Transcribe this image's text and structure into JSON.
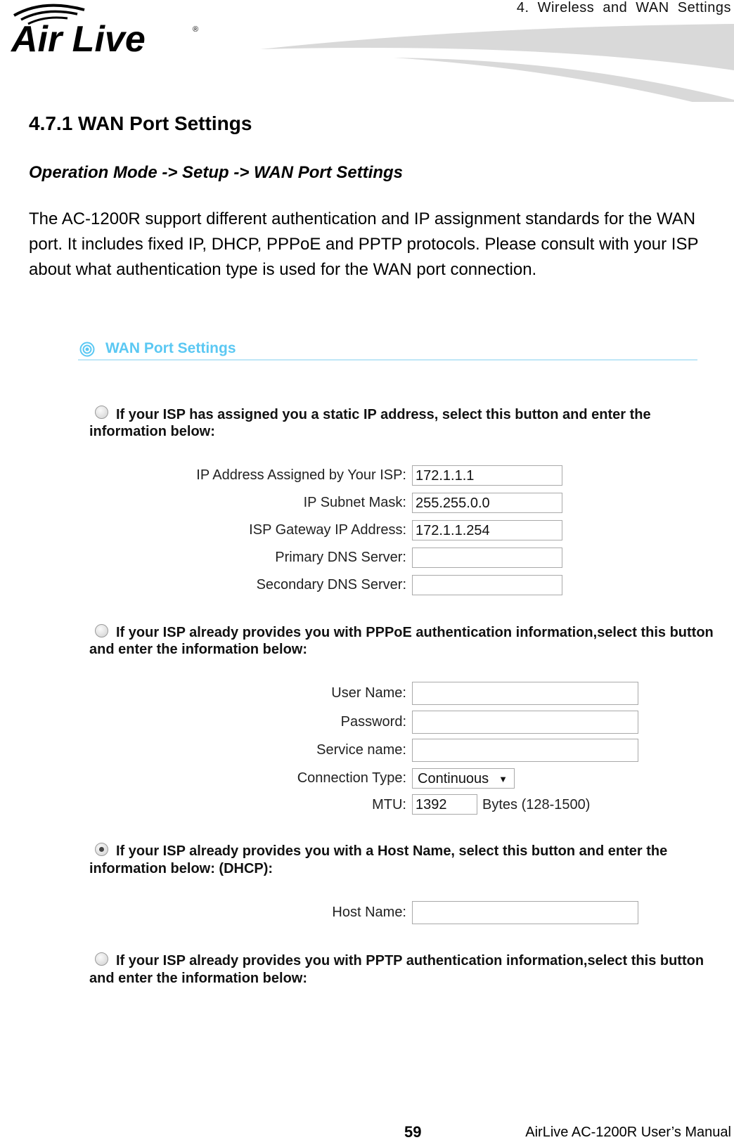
{
  "header": {
    "chapter": "4.  Wireless  and  WAN  Settings",
    "logo_text": "Air Live"
  },
  "section": {
    "heading": "4.7.1 WAN Port Settings",
    "path": "Operation Mode -> Setup -> WAN Port Settings",
    "paragraph": [
      "The AC-1200R support different authentication and IP assignment standards for the WAN",
      "port. It includes fixed IP, DHCP, PPPoE and PPTP protocols. Please consult with your ISP",
      "about what authentication type is used for the WAN port connection."
    ]
  },
  "ui": {
    "title": "WAN Port Settings",
    "static": {
      "option": [
        "If your ISP has assigned you a static IP address, select this button and enter the",
        "information below:"
      ],
      "selected": false,
      "fields": [
        {
          "label": "IP Address Assigned by Your ISP:",
          "value": "172.1.1.1"
        },
        {
          "label": "IP Subnet Mask:",
          "value": "255.255.0.0"
        },
        {
          "label": "ISP Gateway IP Address:",
          "value": "172.1.1.254"
        },
        {
          "label": "Primary DNS Server:",
          "value": ""
        },
        {
          "label": "Secondary DNS Server:",
          "value": ""
        }
      ]
    },
    "pppoe": {
      "option": [
        "If your ISP already provides you with PPPoE authentication information,select this button",
        "and enter the information below:"
      ],
      "selected": false,
      "fields": [
        {
          "label": "User Name:",
          "value": ""
        },
        {
          "label": "Password:",
          "value": ""
        },
        {
          "label": "Service name:",
          "value": ""
        }
      ],
      "connection_type_label": "Connection Type:",
      "connection_type": "Continuous",
      "mtu_label": "MTU:",
      "mtu": "1392",
      "mtu_unit": "Bytes (128-1500)"
    },
    "dhcp": {
      "option": [
        "If your ISP already provides you with a Host Name, select this button and enter the",
        "information below: (DHCP):"
      ],
      "selected": true,
      "host_label": "Host Name:",
      "host_value": ""
    },
    "pptp": {
      "option": [
        "If your ISP already provides you with PPTP authentication information,select this button",
        "and enter the information below:"
      ],
      "selected": false
    }
  },
  "footer": {
    "page": "59",
    "manual": "AirLive AC-1200R User’s Manual"
  },
  "colors": {
    "accent": "#5bc8f3"
  }
}
